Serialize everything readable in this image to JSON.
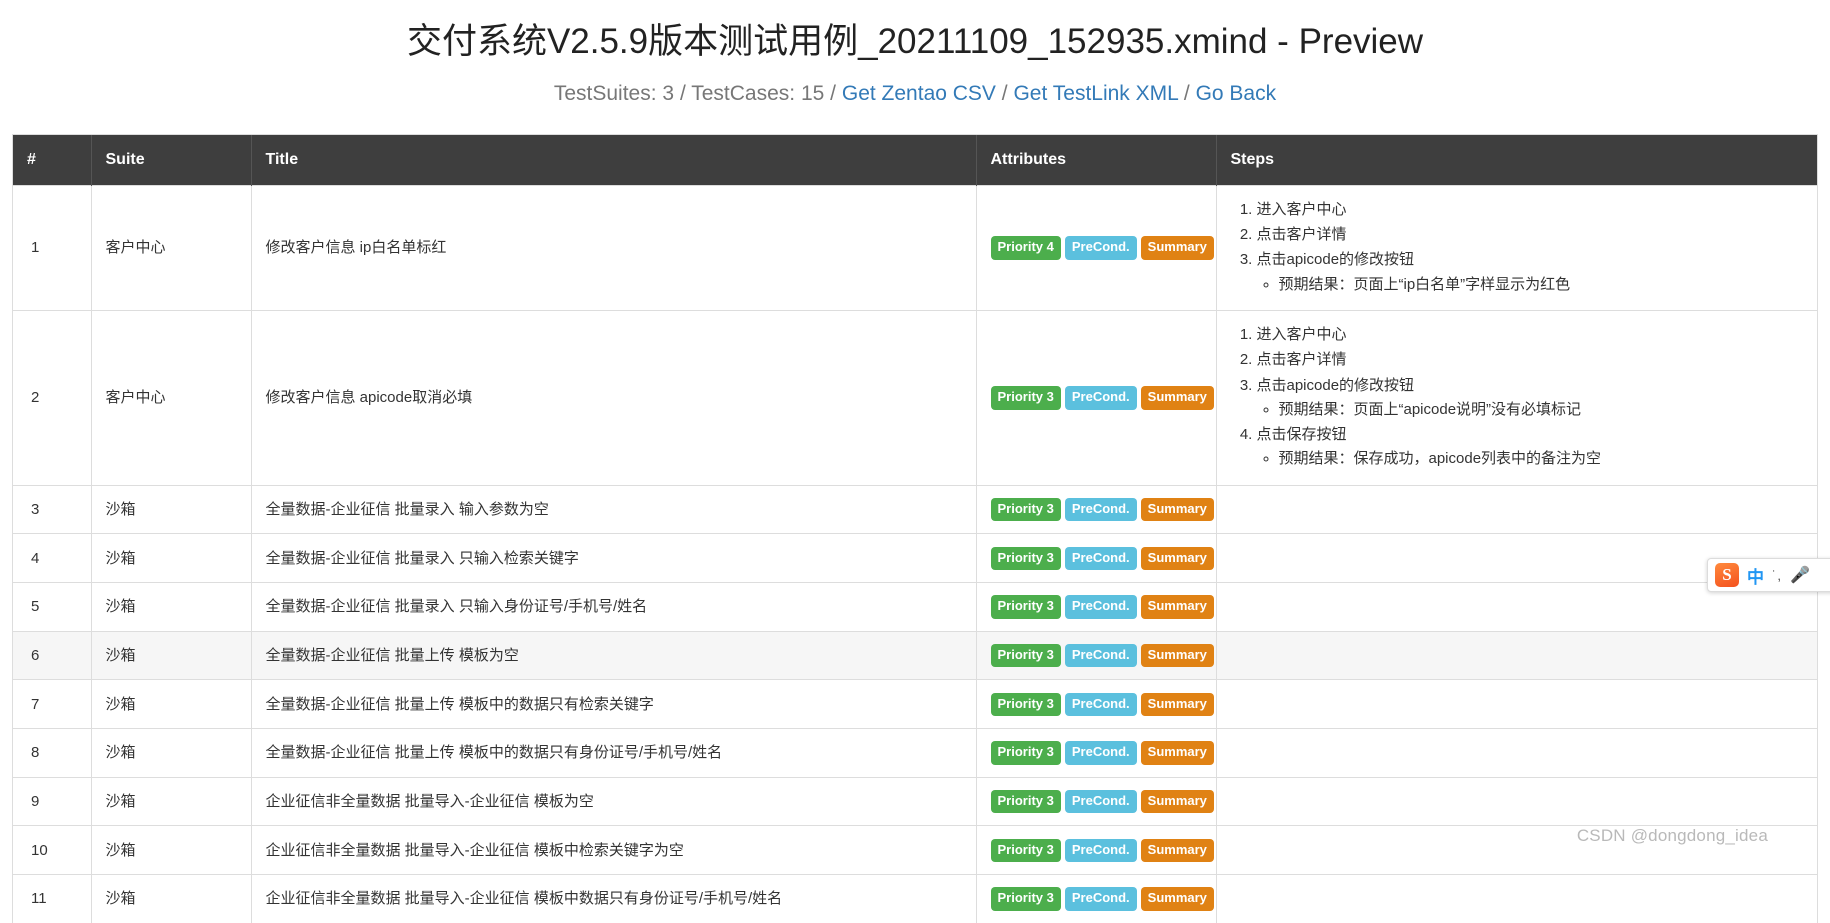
{
  "header": {
    "title": "交付系统V2.5.9版本测试用例_20211109_152935.xmind - Preview",
    "stats_suites": "TestSuites: 3",
    "sep1": "/",
    "stats_cases": "TestCases: 15",
    "sep2": "/",
    "link_zentao": "Get Zentao CSV",
    "sep3": "/",
    "link_testlink": "Get TestLink XML",
    "sep4": "/",
    "link_back": "Go Back"
  },
  "table": {
    "columns": {
      "index": "#",
      "suite": "Suite",
      "title": "Title",
      "attributes": "Attributes",
      "steps": "Steps"
    },
    "badge_labels": {
      "priority4": "Priority 4",
      "priority3": "Priority 3",
      "precond": "PreCond.",
      "summary": "Summary"
    },
    "rows": [
      {
        "index": "1",
        "suite": "客户中心",
        "title": "修改客户信息 ip白名单标红",
        "priority": "Priority 4",
        "precond": "PreCond.",
        "summary": "Summary",
        "steps": [
          {
            "text": "进入客户中心",
            "sub": []
          },
          {
            "text": "点击客户详情",
            "sub": []
          },
          {
            "text": "点击apicode的修改按钮",
            "sub": [
              "预期结果：页面上“ip白名单”字样显示为红色"
            ]
          }
        ]
      },
      {
        "index": "2",
        "suite": "客户中心",
        "title": "修改客户信息 apicode取消必填",
        "priority": "Priority 3",
        "precond": "PreCond.",
        "summary": "Summary",
        "steps": [
          {
            "text": "进入客户中心",
            "sub": []
          },
          {
            "text": "点击客户详情",
            "sub": []
          },
          {
            "text": "点击apicode的修改按钮",
            "sub": [
              "预期结果：页面上“apicode说明”没有必填标记"
            ]
          },
          {
            "text": "点击保存按钮",
            "sub": [
              "预期结果：保存成功，apicode列表中的备注为空"
            ]
          }
        ]
      },
      {
        "index": "3",
        "suite": "沙箱",
        "title": "全量数据-企业征信 批量录入 输入参数为空",
        "priority": "Priority 3",
        "precond": "PreCond.",
        "summary": "Summary",
        "steps": []
      },
      {
        "index": "4",
        "suite": "沙箱",
        "title": "全量数据-企业征信 批量录入 只输入检索关键字",
        "priority": "Priority 3",
        "precond": "PreCond.",
        "summary": "Summary",
        "steps": []
      },
      {
        "index": "5",
        "suite": "沙箱",
        "title": "全量数据-企业征信 批量录入 只输入身份证号/手机号/姓名",
        "priority": "Priority 3",
        "precond": "PreCond.",
        "summary": "Summary",
        "steps": []
      },
      {
        "index": "6",
        "suite": "沙箱",
        "title": "全量数据-企业征信 批量上传 模板为空",
        "priority": "Priority 3",
        "precond": "PreCond.",
        "summary": "Summary",
        "steps": []
      },
      {
        "index": "7",
        "suite": "沙箱",
        "title": "全量数据-企业征信 批量上传 模板中的数据只有检索关键字",
        "priority": "Priority 3",
        "precond": "PreCond.",
        "summary": "Summary",
        "steps": []
      },
      {
        "index": "8",
        "suite": "沙箱",
        "title": "全量数据-企业征信 批量上传 模板中的数据只有身份证号/手机号/姓名",
        "priority": "Priority 3",
        "precond": "PreCond.",
        "summary": "Summary",
        "steps": []
      },
      {
        "index": "9",
        "suite": "沙箱",
        "title": "企业征信非全量数据 批量导入-企业征信 模板为空",
        "priority": "Priority 3",
        "precond": "PreCond.",
        "summary": "Summary",
        "steps": []
      },
      {
        "index": "10",
        "suite": "沙箱",
        "title": "企业征信非全量数据 批量导入-企业征信 模板中检索关键字为空",
        "priority": "Priority 3",
        "precond": "PreCond.",
        "summary": "Summary",
        "steps": []
      },
      {
        "index": "11",
        "suite": "沙箱",
        "title": "企业征信非全量数据 批量导入-企业征信 模板中数据只有身份证号/手机号/姓名",
        "priority": "Priority 3",
        "precond": "PreCond.",
        "summary": "Summary",
        "steps": []
      }
    ]
  },
  "ime_toolbar": {
    "logo": "S",
    "mode": "中",
    "dots": "˙,",
    "mic": "🎤"
  },
  "watermark": "CSDN @dongdong_idea",
  "colors": {
    "header_bg": "#3e3e3e",
    "link": "#337ab7",
    "priority": "#4cae4c",
    "precond": "#5bc0de",
    "summary": "#e08214"
  }
}
